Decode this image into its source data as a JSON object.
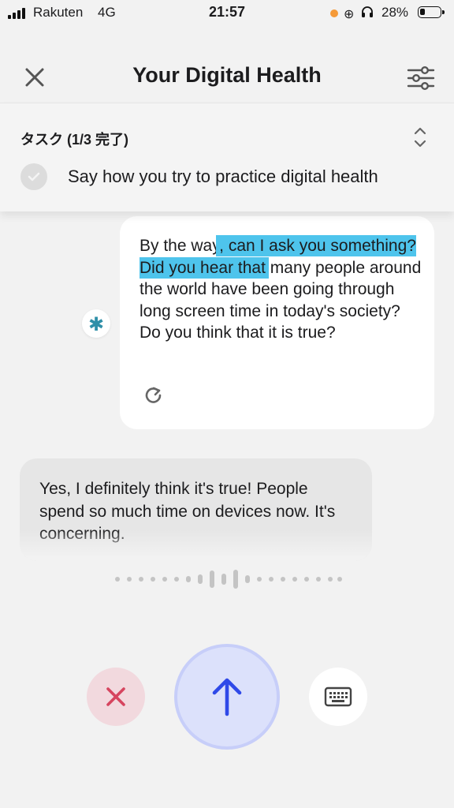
{
  "status_bar": {
    "carrier": "Rakuten",
    "network": "4G",
    "time": "21:57",
    "battery_percent": "28%",
    "battery_level": 0.28
  },
  "header": {
    "title": "Your Digital Health",
    "close_icon": "close-icon",
    "settings_icon": "sliders-icon"
  },
  "task": {
    "title": "タスク (1/3 完了)",
    "item_text": "Say how you try to practice digital health",
    "item_completed": true
  },
  "messages": {
    "bot": {
      "avatar_icon": "asterisk-icon",
      "text_before": "By the way",
      "text_highlight": ", can I ask you something? Did you hear that",
      "text_after": " many people around the world have been going through long screen time in today's society? Do you think that it is true?",
      "highlight_color": "#4ec4ec",
      "replay_icon": "replay-icon"
    },
    "user": {
      "text": "Yes, I definitely think it's true! People spend so much time on devices now. It's concerning."
    }
  },
  "controls": {
    "cancel_icon": "x-icon",
    "send_icon": "arrow-up-icon",
    "keyboard_icon": "keyboard-icon",
    "cancel_color": "#d6455f",
    "send_color": "#2f49e8"
  }
}
